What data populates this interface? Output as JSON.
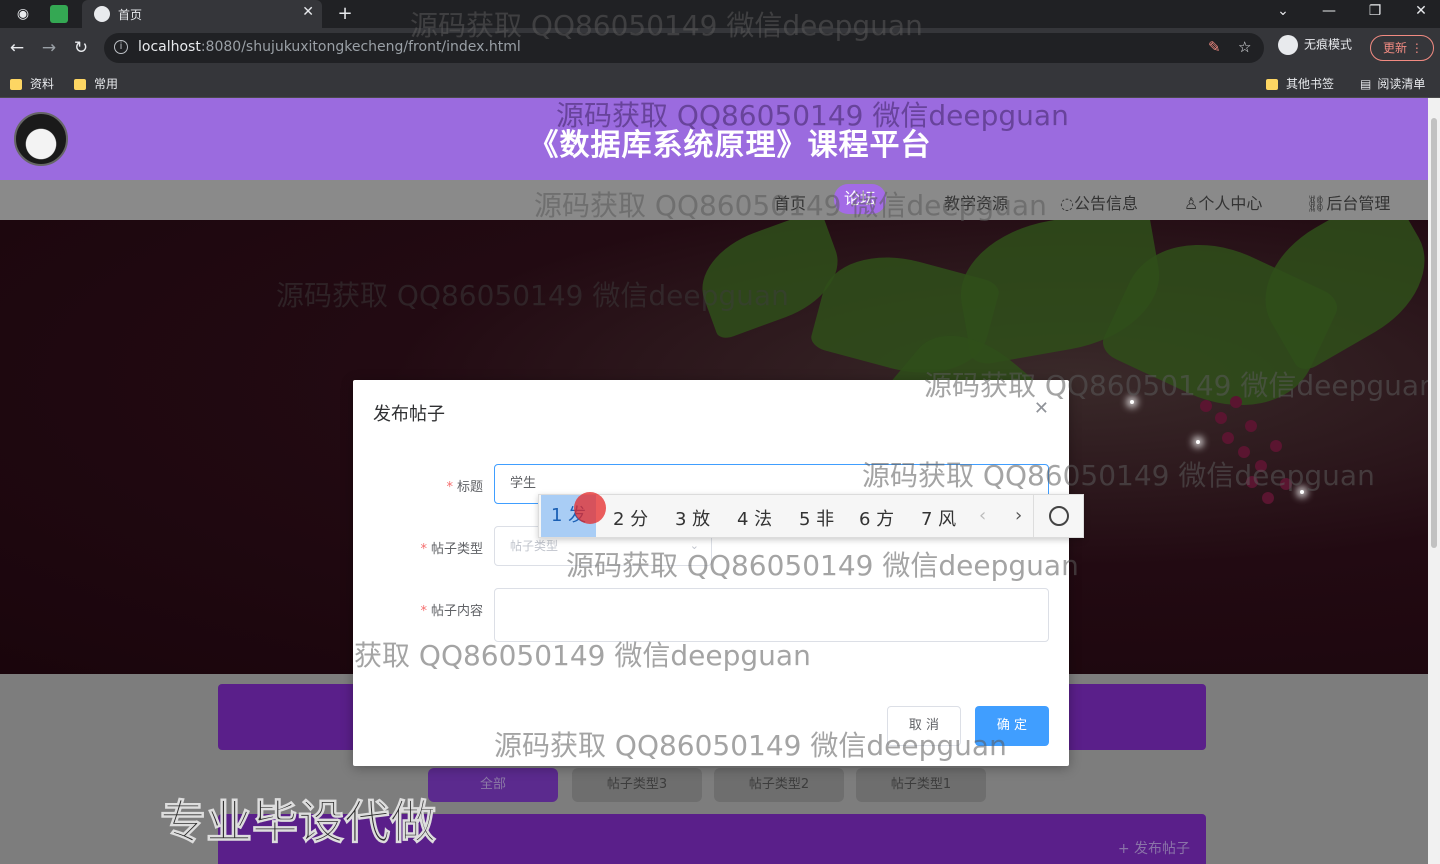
{
  "browser": {
    "tab_title": "首页",
    "url_host": "localhost",
    "url_path": ":8080/shujukuxitongkecheng/front/index.html",
    "incognito_label": "无痕模式",
    "update_label": "更新",
    "bookmarks": [
      "资料",
      "常用"
    ],
    "bookmarks_right": [
      "其他书签",
      "阅读清单"
    ]
  },
  "site": {
    "title": "《数据库系统原理》课程平台",
    "nav": [
      "首页",
      "论坛",
      "教学资源",
      "公告信息",
      "个人中心",
      "后台管理"
    ],
    "nav_active_index": 1,
    "filters": [
      "全部",
      "帖子类型3",
      "帖子类型2",
      "帖子类型1"
    ],
    "post_button": "+ 发布帖子",
    "accent_color": "#9b6bdf"
  },
  "dialog": {
    "title": "发布帖子",
    "fields": {
      "title_label": "标题",
      "title_value": "学生",
      "type_label": "帖子类型",
      "type_placeholder": "帖子类型",
      "content_label": "帖子内容"
    },
    "cancel_label": "取 消",
    "ok_label": "确 定"
  },
  "ime": {
    "candidates": [
      "1 发",
      "2 分",
      "3 放",
      "4 法",
      "5 非",
      "6 方",
      "7 风"
    ]
  },
  "overlays": {
    "watermark": "源码获取 QQ86050149 微信deepguan",
    "watermark_partial": "获取 QQ86050149 微信deepguan",
    "corner_ad": "专业毕设代做"
  }
}
